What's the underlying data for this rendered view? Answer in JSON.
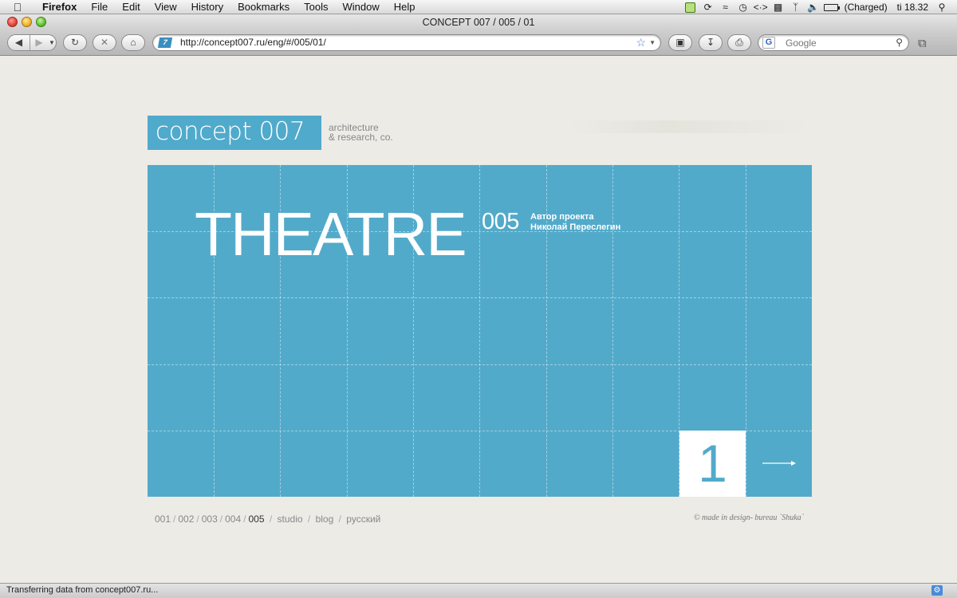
{
  "menubar": {
    "app_name": "Firefox",
    "menus": [
      "File",
      "Edit",
      "View",
      "History",
      "Bookmarks",
      "Tools",
      "Window",
      "Help"
    ],
    "battery_status": "(Charged)",
    "clock": "ti 18.32"
  },
  "window": {
    "title": "CONCEPT 007 / 005 / 01"
  },
  "toolbar": {
    "url": "http://concept007.ru/eng/#/005/01/",
    "search_placeholder": "Google"
  },
  "site": {
    "logo_text": "concept 007",
    "tagline": [
      "architecture",
      "& research, co."
    ],
    "accent_color": "#52aaca"
  },
  "slide": {
    "title": "THEATRE",
    "number": "005",
    "author_label": "Автор проекта",
    "author_name": "Николай Переслегин",
    "image_index": "1"
  },
  "footer": {
    "nav": [
      {
        "label": "001",
        "current": false
      },
      {
        "label": "002",
        "current": false
      },
      {
        "label": "003",
        "current": false
      },
      {
        "label": "004",
        "current": false
      },
      {
        "label": "005",
        "current": true
      }
    ],
    "links": [
      "studio",
      "blog",
      "русский"
    ],
    "credits": "© made in design- bureau `Shuka`"
  },
  "statusbar": {
    "text": "Transferring data from concept007.ru..."
  }
}
